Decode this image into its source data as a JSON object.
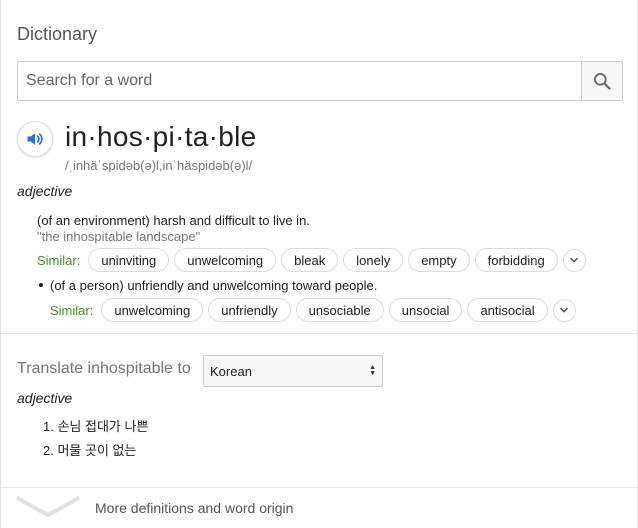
{
  "panel": {
    "title": "Dictionary"
  },
  "search": {
    "placeholder": "Search for a word",
    "value": ""
  },
  "entry": {
    "word": "in·hos·pi·ta·ble",
    "phonetic": "/ˌinhäˈspidəb(ə)l,inˈhäspidəb(ə)l/",
    "part_of_speech": "adjective",
    "senses": [
      {
        "definition": "(of an environment) harsh and difficult to live in.",
        "example": "\"the inhospitable landscape\"",
        "similar_label": "Similar:",
        "similar": [
          "uninviting",
          "unwelcoming",
          "bleak",
          "lonely",
          "empty",
          "forbidding"
        ]
      },
      {
        "definition": "(of a person) unfriendly and unwelcoming toward people.",
        "similar_label": "Similar:",
        "similar": [
          "unwelcoming",
          "unfriendly",
          "unsociable",
          "unsocial",
          "antisocial"
        ]
      }
    ]
  },
  "translate": {
    "label": "Translate inhospitable to",
    "language": "Korean",
    "part_of_speech": "adjective",
    "items": [
      "1. 손님 접대가 나쁜",
      "2. 머물 곳이 없는"
    ]
  },
  "footer": {
    "more_label": "More definitions and word origin"
  },
  "colors": {
    "similar_label": "#4d8a2f",
    "speaker": "#1a73e8",
    "muted": "#777777"
  },
  "icons": {
    "search": "search-icon",
    "speaker": "speaker-icon",
    "expand": "chevron-down-icon"
  }
}
